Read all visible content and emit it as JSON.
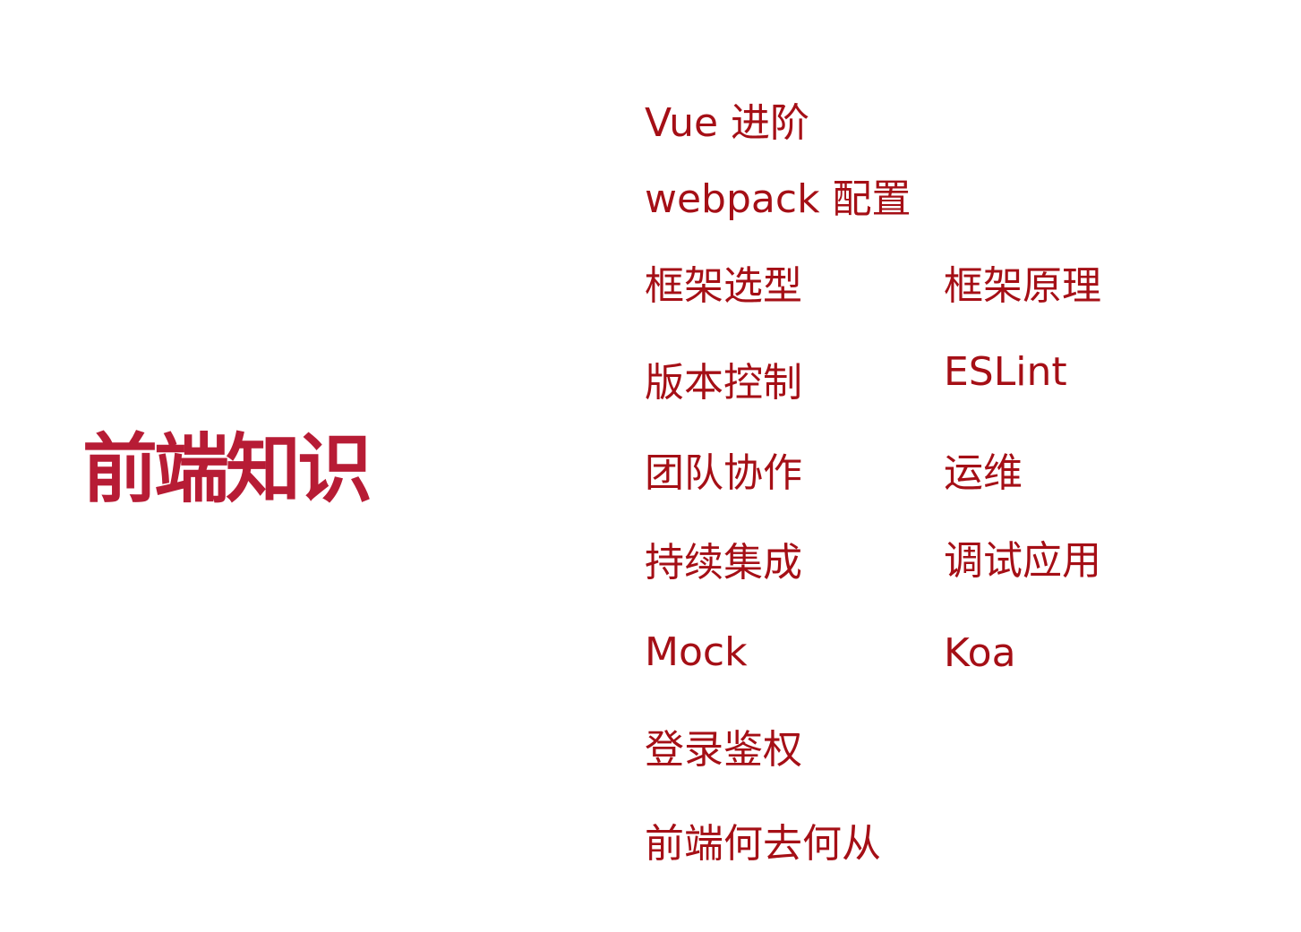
{
  "slide": {
    "title": "前端知识",
    "topics": {
      "vue": "Vue 进阶",
      "webpack": "webpack 配置",
      "framework_selection": "框架选型",
      "framework_principles": "框架原理",
      "version_control": "版本控制",
      "eslint": "ESLint",
      "team_collaboration": "团队协作",
      "devops": "运维",
      "continuous_integration": "持续集成",
      "debugging": "调试应用",
      "mock": "Mock",
      "koa": "Koa",
      "login_auth": "登录鉴权",
      "frontend_future": "前端何去何从"
    },
    "colors": {
      "title": "#b71c35",
      "topic": "#a50f16",
      "background": "#ffffff"
    }
  }
}
